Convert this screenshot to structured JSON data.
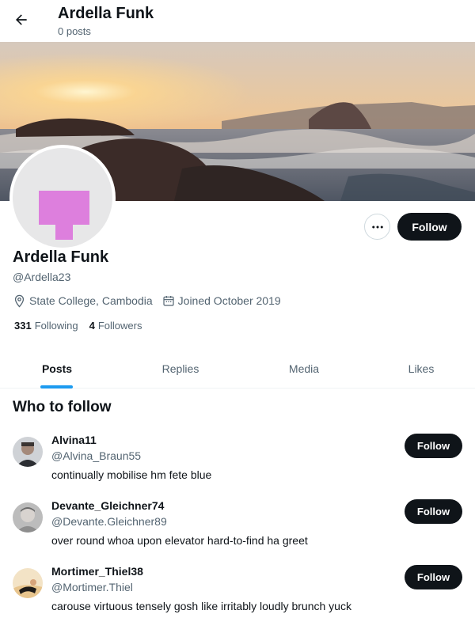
{
  "header": {
    "name": "Ardella Funk",
    "posts_count": "0 posts"
  },
  "profile": {
    "name": "Ardella Funk",
    "handle": "@Ardella23",
    "location": "State College, Cambodia",
    "joined": "Joined October 2019",
    "following_count": "331",
    "following_label": "Following",
    "followers_count": "4",
    "followers_label": "Followers",
    "follow_label": "Follow",
    "avatar_color": "#dd7fdd"
  },
  "tabs": [
    {
      "label": "Posts",
      "active": true
    },
    {
      "label": "Replies",
      "active": false
    },
    {
      "label": "Media",
      "active": false
    },
    {
      "label": "Likes",
      "active": false
    }
  ],
  "who_to_follow": {
    "title": "Who to follow",
    "items": [
      {
        "name": "Alvina11",
        "handle": "@Alvina_Braun55",
        "bio": "continually mobilise hm fete blue",
        "follow_label": "Follow"
      },
      {
        "name": "Devante_Gleichner74",
        "handle": "@Devante.Gleichner89",
        "bio": "over round whoa upon elevator hard-to-find ha greet",
        "follow_label": "Follow"
      },
      {
        "name": "Mortimer_Thiel38",
        "handle": "@Mortimer.Thiel",
        "bio": "carouse virtuous tensely gosh like irritably loudly brunch yuck",
        "follow_label": "Follow"
      }
    ]
  },
  "colors": {
    "accent": "#1d9bf0",
    "button_dark": "#0f1419",
    "secondary_text": "#536471"
  },
  "icons": {
    "back": "arrow-left-icon",
    "more": "more-horizontal-icon",
    "location": "location-pin-icon",
    "calendar": "calendar-icon"
  }
}
